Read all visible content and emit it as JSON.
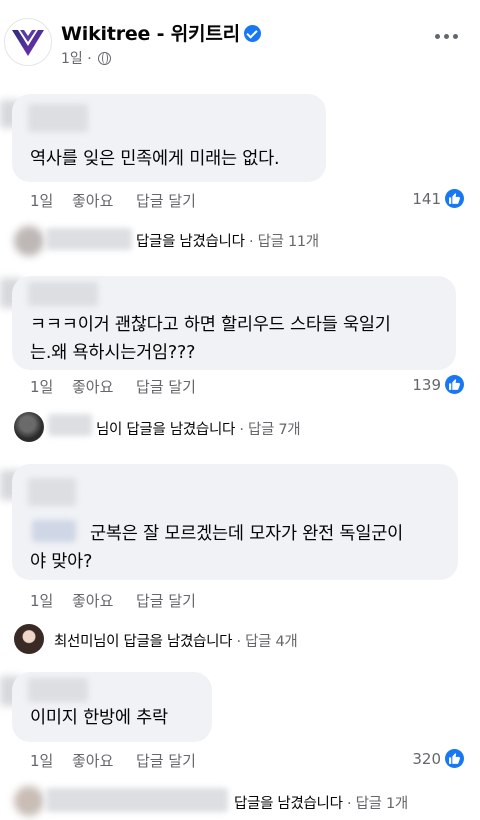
{
  "header": {
    "page_name": "Wikitree - 위키트리",
    "post_age": "1일",
    "separator": "·"
  },
  "actions": {
    "like": "좋아요",
    "reply": "답글 달기"
  },
  "comments": [
    {
      "text_lines": [
        "역사를 잊은 민족에게 미래는 없다."
      ],
      "age": "1일",
      "reactions": "141",
      "replies": {
        "author": "",
        "summary": "답글을 남겼습니다",
        "count": "· 답글 11개"
      }
    },
    {
      "text_lines": [
        "ㅋㅋㅋ이거 괜찮다고 하면 할리우드 스타들 욱일기",
        "는.왜 욕하시는거임???"
      ],
      "age": "1일",
      "reactions": "139",
      "replies": {
        "author": "",
        "summary": "님이 답글을 남겼습니다",
        "count": "· 답글 7개"
      }
    },
    {
      "text_lines": [
        "군복은 잘 모르겠는데 모자가 완전 독일군이",
        "야 맞아?"
      ],
      "age": "1일",
      "reactions": "",
      "replies": {
        "author": "최선미",
        "summary": "님이 답글을 남겼습니다",
        "count": "· 답글 4개"
      }
    },
    {
      "text_lines": [
        "이미지 한방에 추락"
      ],
      "age": "1일",
      "reactions": "320",
      "replies": {
        "author": "",
        "summary": "답글을 남겼습니다",
        "count": "· 답글 1개"
      }
    }
  ],
  "colors": {
    "brand_blue": "#1877f2",
    "bubble": "#f0f2f5",
    "muted": "#65676b"
  }
}
